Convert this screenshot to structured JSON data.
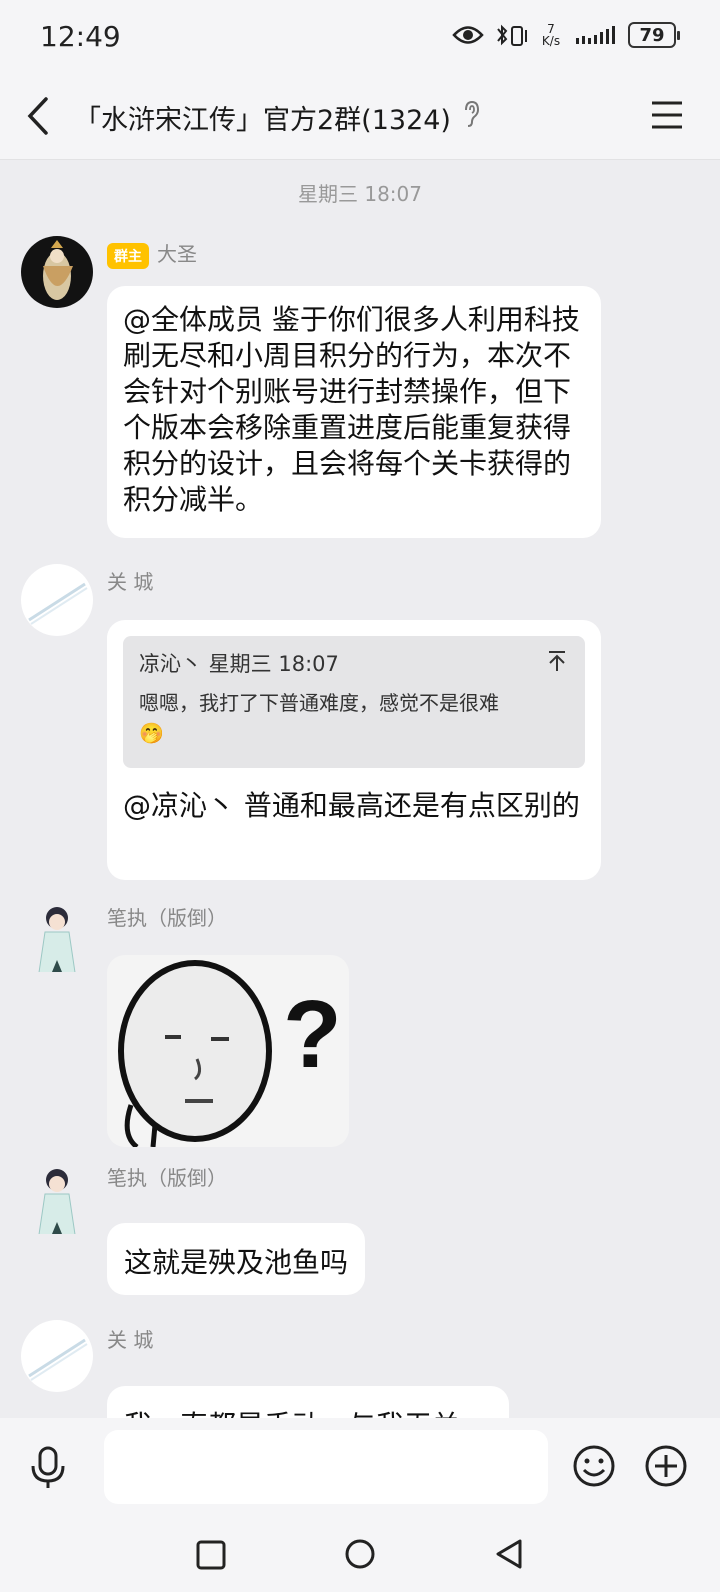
{
  "status": {
    "time": "12:49",
    "net_speed_top": "7",
    "net_speed_unit": "K/s",
    "battery": "79"
  },
  "header": {
    "title": "「水浒宋江传」官方2群(1324)"
  },
  "chat": {
    "timestamp": "星期三 18:07",
    "messages": [
      {
        "sender": "大圣",
        "badge": "群主",
        "text": "@全体成员 鉴于你们很多人利用科技刷无尽和小周目积分的行为，本次不会针对个别账号进行封禁操作，但下个版本会移除重置进度后能重复获得积分的设计，且会将每个关卡获得的积分减半。"
      },
      {
        "sender": "关 城",
        "quote_header": "凉沁丶  星期三 18:07",
        "quote_text": "嗯嗯，我打了下普通难度，感觉不是很难",
        "quote_emoji": "🤭",
        "text": "@凉沁丶 普通和最高还是有点区别的"
      },
      {
        "sender": "笔执（版倒）",
        "sticker_text": "?"
      },
      {
        "sender": "笔执（版倒）",
        "text": "这就是殃及池鱼吗"
      },
      {
        "sender": "关 城",
        "text": "我一直都是手动，与我无关"
      }
    ]
  },
  "input": {
    "placeholder": ""
  }
}
